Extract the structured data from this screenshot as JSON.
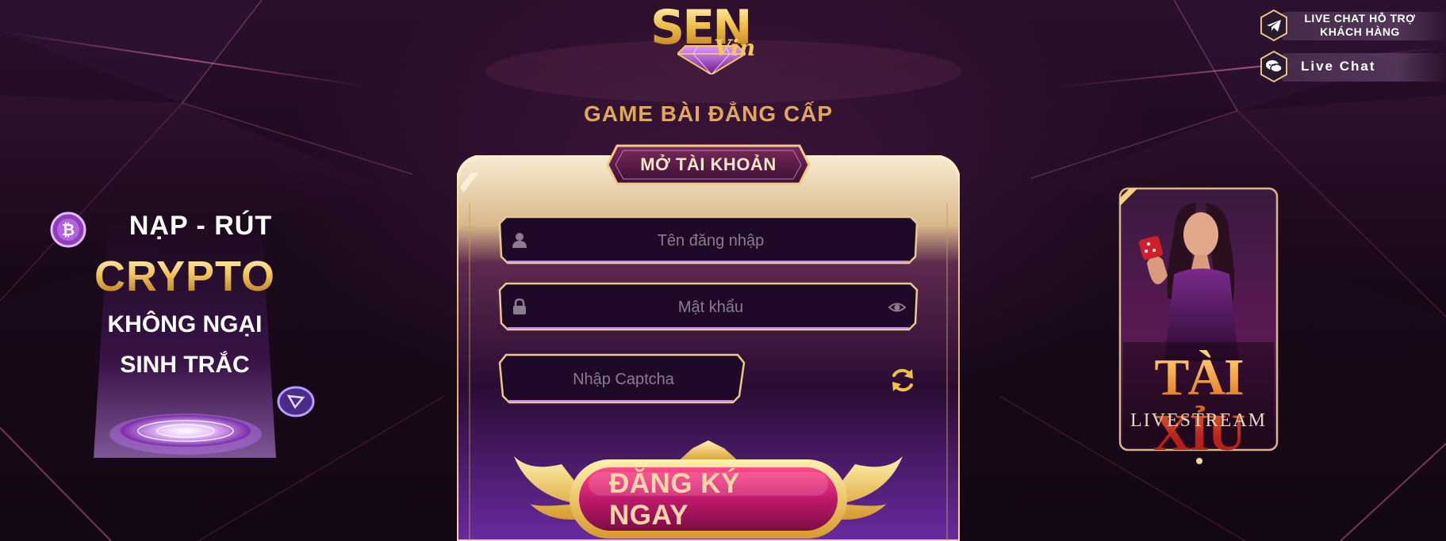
{
  "header": {
    "logo_text": "SEN",
    "logo_sub": "Vin",
    "tagline": "GAME BÀI ĐẲNG CẤP"
  },
  "support": {
    "live_chat_support_label": "LIVE CHAT HỖ TRỢ KHÁCH HÀNG",
    "live_chat_label": "Live Chat",
    "telegram_icon": "telegram-icon",
    "chat_icon": "chat-bubble-icon"
  },
  "promo_left": {
    "line1": "NẠP - RÚT",
    "line2": "CRYPTO",
    "line3": "KHÔNG NGẠI",
    "line4": "SINH TRẮC"
  },
  "register_form": {
    "title": "MỞ TÀI KHOẢN",
    "username": {
      "placeholder": "Tên đăng nhập",
      "value": ""
    },
    "password": {
      "placeholder": "Mật khẩu",
      "value": ""
    },
    "captcha": {
      "placeholder": "Nhập Captcha",
      "value": ""
    },
    "submit_label": "ĐĂNG KÝ NGAY"
  },
  "promo_right": {
    "title": "TÀI XỈU",
    "subtitle": "LIVESTREAM"
  },
  "colors": {
    "gold": "#f3c75a",
    "accent_magenta": "#c0196b",
    "panel_purple": "#2c0f36"
  }
}
